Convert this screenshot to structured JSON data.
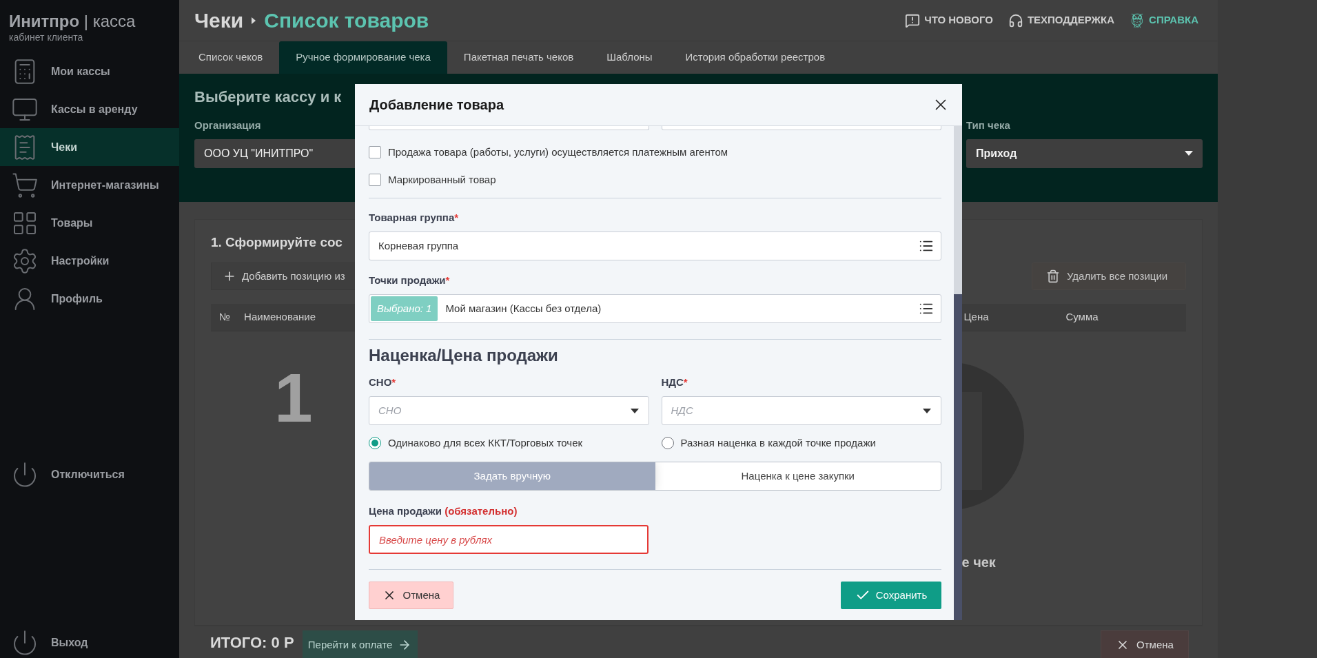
{
  "sidebar": {
    "logo": "**Инитпро** | касса",
    "subtitle": "кабинет клиента",
    "items": [
      {
        "label": "Мои кассы",
        "selected": false
      },
      {
        "label": "Кассы в аренду",
        "selected": false
      },
      {
        "label": "Чеки",
        "selected": true
      },
      {
        "label": "Интернет-магазины",
        "selected": false
      },
      {
        "label": "Товары",
        "selected": false
      },
      {
        "label": "Настройки",
        "selected": false
      },
      {
        "label": "Профиль",
        "selected": false
      }
    ],
    "disconnect": "Отключиться",
    "logout": "Выход"
  },
  "header": {
    "breadcrumb": [
      "Чеки",
      "Список товаров"
    ],
    "links": [
      {
        "label": "ЧТО НОВОГО",
        "active": false
      },
      {
        "label": "ТЕХПОДДЕРЖКА",
        "active": false
      },
      {
        "label": "СПРАВКА",
        "active": true
      }
    ]
  },
  "tabs": [
    {
      "label": "Список чеков",
      "selected": false
    },
    {
      "label": "Ручное формирование чека",
      "selected": true
    },
    {
      "label": "Пакетная печать чеков",
      "selected": false
    },
    {
      "label": "Шаблоны",
      "selected": false
    },
    {
      "label": "История обработки реестров",
      "selected": false
    }
  ],
  "band": {
    "title": "Выберите кассу и к",
    "organization": {
      "label": "Организация",
      "value": "ООО УЦ \"ИНИТПРО\""
    },
    "receipt_type": {
      "label": "Тип чека",
      "value": "Приход"
    }
  },
  "card": {
    "title": "1. Сформируйте сос",
    "add_button": "Добавить позицию из",
    "delete_button": "Удалить все позиции",
    "columns": [
      "№",
      "Наименование",
      "Цена",
      "Сумма"
    ],
    "step_number": "1",
    "hint": "е чек"
  },
  "footer": {
    "total": "ИТОГО: 0 Р",
    "pay_button": "Перейти к оплате",
    "cancel_button": "Отмена"
  },
  "modal": {
    "title": "Добавление товара",
    "checkboxes": [
      {
        "label": "Продажа товара (работы, услуги) осуществляется платежным агентом",
        "checked": false
      },
      {
        "label": "Маркированный товар",
        "checked": false
      }
    ],
    "product_group": {
      "label": "Товарная группа",
      "required_mark": "*",
      "value": "Корневая группа"
    },
    "sale_points": {
      "label": "Точки продажи",
      "required_mark": "*",
      "badge": "Выбрано: 1",
      "value": "Мой магазин (Кассы без отдела)"
    },
    "section_title": "Наценка/Цена продажи",
    "selects": [
      {
        "label": "СНО",
        "required_mark": "*",
        "placeholder": "СНО"
      },
      {
        "label": "НДС",
        "required_mark": "*",
        "placeholder": "НДС"
      }
    ],
    "radios": [
      {
        "label": "Одинаково для всех ККТ/Торговых точек",
        "selected": true
      },
      {
        "label": "Разная наценка в каждой точке продажи",
        "selected": false
      }
    ],
    "modes": [
      {
        "label": "Задать вручную",
        "selected": true
      },
      {
        "label": "Наценка к цене закупки",
        "selected": false
      }
    ],
    "price": {
      "label": "Цена продажи",
      "required_note": "(обязательно)",
      "placeholder": "Введите цену в рублях",
      "error": true
    },
    "cancel_button": "Отмена",
    "save_button": "Сохранить"
  }
}
